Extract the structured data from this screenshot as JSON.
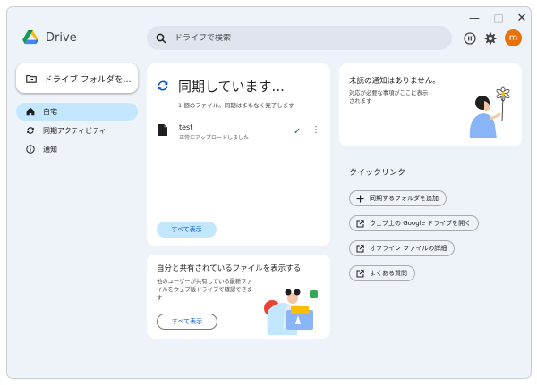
{
  "window": {
    "close_glyph": "✕",
    "min_glyph": "—",
    "max_glyph": "□"
  },
  "app": {
    "name": "Drive"
  },
  "search": {
    "placeholder": "ドライブで検索"
  },
  "user": {
    "avatar_letter": "m",
    "avatar_color": "#e8710a"
  },
  "sidebar": {
    "folder_button": "ドライブ フォルダを...",
    "items": [
      {
        "label": "自宅",
        "icon": "home-icon",
        "active": true
      },
      {
        "label": "同期アクティビティ",
        "icon": "sync-icon",
        "active": false
      },
      {
        "label": "通知",
        "icon": "info-icon",
        "active": false
      }
    ]
  },
  "sync_card": {
    "title": "同期しています...",
    "subtitle": "1 個のファイル。同期はまもなく完了します",
    "files": [
      {
        "name": "test",
        "status": "正常にアップロードしました"
      }
    ],
    "show_all": "すべて表示"
  },
  "shared_card": {
    "title": "自分と共有されているファイルを表示する",
    "description": "他のユーザーが共有している最新ファイルをウェブ版ドライブで確認できます",
    "show_all": "すべて表示"
  },
  "notifications": {
    "title": "未読の通知はありません。",
    "description": "対応が必要な事項がここに表示されます"
  },
  "quick_links": {
    "title": "クイックリンク",
    "items": [
      {
        "label": "同期するフォルダを追加",
        "icon": "plus-icon"
      },
      {
        "label": "ウェブ上の Google ドライブを開く",
        "icon": "open-external-icon"
      },
      {
        "label": "オフライン ファイルの詳細",
        "icon": "open-external-icon"
      },
      {
        "label": "よくある質問",
        "icon": "open-external-icon"
      }
    ]
  },
  "colors": {
    "accent": "#0b57d0",
    "active_bg": "#c2e7ff",
    "app_bg": "#eef2f9"
  }
}
